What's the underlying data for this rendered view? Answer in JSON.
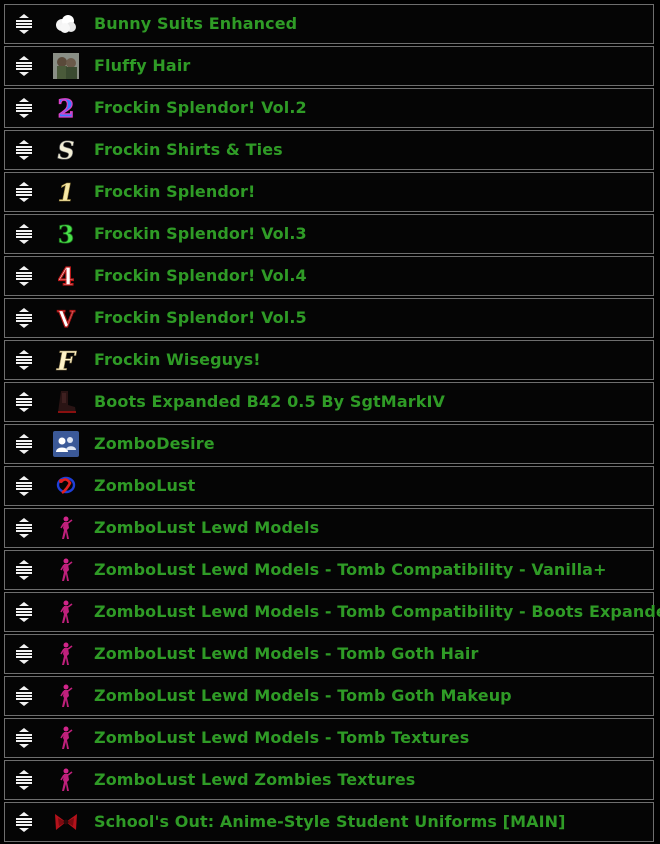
{
  "mods": [
    {
      "name": "Bunny Suits Enhanced",
      "icon": "fluffy-cloud-icon"
    },
    {
      "name": "Fluffy Hair",
      "icon": "character-portrait-icon"
    },
    {
      "name": "Frockin Splendor! Vol.2",
      "icon": "number-2-icon"
    },
    {
      "name": "Frockin Shirts & Ties",
      "icon": "letter-s-icon"
    },
    {
      "name": "Frockin Splendor!",
      "icon": "number-1-icon"
    },
    {
      "name": "Frockin Splendor! Vol.3",
      "icon": "number-3-icon"
    },
    {
      "name": "Frockin Splendor! Vol.4",
      "icon": "number-4-icon"
    },
    {
      "name": "Frockin Splendor! Vol.5",
      "icon": "roman-v-icon"
    },
    {
      "name": "Frockin Wiseguys!",
      "icon": "letter-f-icon"
    },
    {
      "name": "Boots Expanded B42 0.5 By SgtMarkIV",
      "icon": "boot-icon"
    },
    {
      "name": "ZomboDesire",
      "icon": "people-icon"
    },
    {
      "name": "ZomboLust",
      "icon": "zombolust-logo-icon"
    },
    {
      "name": "ZomboLust Lewd Models",
      "icon": "pink-figure-icon"
    },
    {
      "name": "ZomboLust Lewd Models - Tomb Compatibility - Vanilla+",
      "icon": "pink-figure-icon"
    },
    {
      "name": "ZomboLust Lewd Models - Tomb Compatibility - Boots Expanded",
      "icon": "pink-figure-icon"
    },
    {
      "name": "ZomboLust Lewd Models - Tomb Goth Hair",
      "icon": "pink-figure-icon"
    },
    {
      "name": "ZomboLust Lewd Models - Tomb Goth Makeup",
      "icon": "pink-figure-icon"
    },
    {
      "name": "ZomboLust Lewd Models - Tomb Textures",
      "icon": "pink-figure-icon"
    },
    {
      "name": "ZomboLust Lewd Zombies Textures",
      "icon": "pink-figure-icon"
    },
    {
      "name": "School's Out: Anime-Style Student Uniforms [MAIN]",
      "icon": "red-ribbon-icon"
    }
  ],
  "colors": {
    "mod_name": "#2f9b26",
    "row_border": "#6e6e6e",
    "background": "#000000"
  }
}
